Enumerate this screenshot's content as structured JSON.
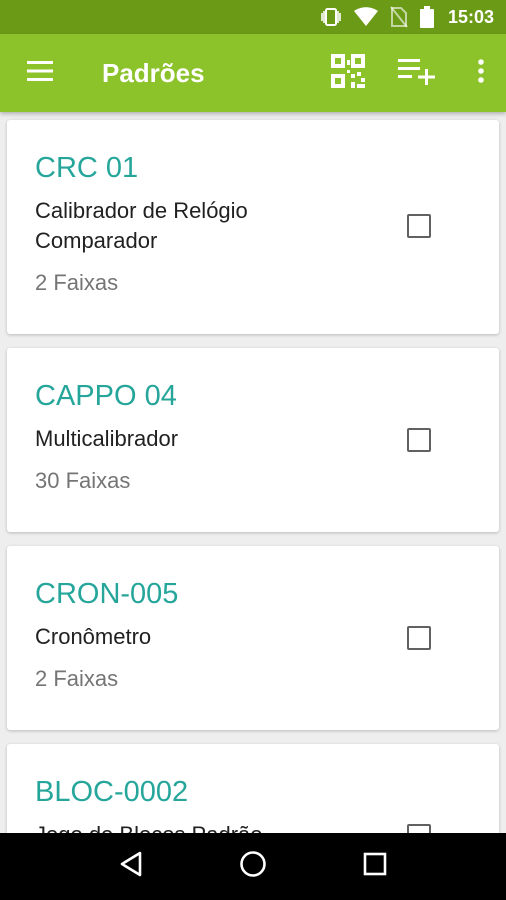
{
  "status_bar": {
    "time": "15:03",
    "icons": [
      "vibrate-icon",
      "wifi-icon",
      "no-sim-icon",
      "battery-icon"
    ]
  },
  "app_bar": {
    "title": "Padrões",
    "actions": [
      "menu-icon",
      "qr-code-icon",
      "playlist-add-icon",
      "more-vert-icon"
    ],
    "color": "#8cc22a",
    "status_color": "#6a9a16"
  },
  "colors": {
    "accent": "#26a69a"
  },
  "cards": [
    {
      "code": "CRC 01",
      "name": "Calibrador de Relógio Comparador",
      "ranges": "2 Faixas",
      "checked": false
    },
    {
      "code": "CAPPO 04",
      "name": "Multicalibrador",
      "ranges": "30 Faixas",
      "checked": false
    },
    {
      "code": "CRON-005",
      "name": "Cronômetro",
      "ranges": "2 Faixas",
      "checked": false
    },
    {
      "code": "BLOC-0002",
      "name": "Jogo de Blocos Padrão",
      "ranges": "",
      "checked": false
    }
  ],
  "nav_bar": {
    "buttons": [
      "back-icon",
      "home-icon",
      "recents-icon"
    ]
  }
}
